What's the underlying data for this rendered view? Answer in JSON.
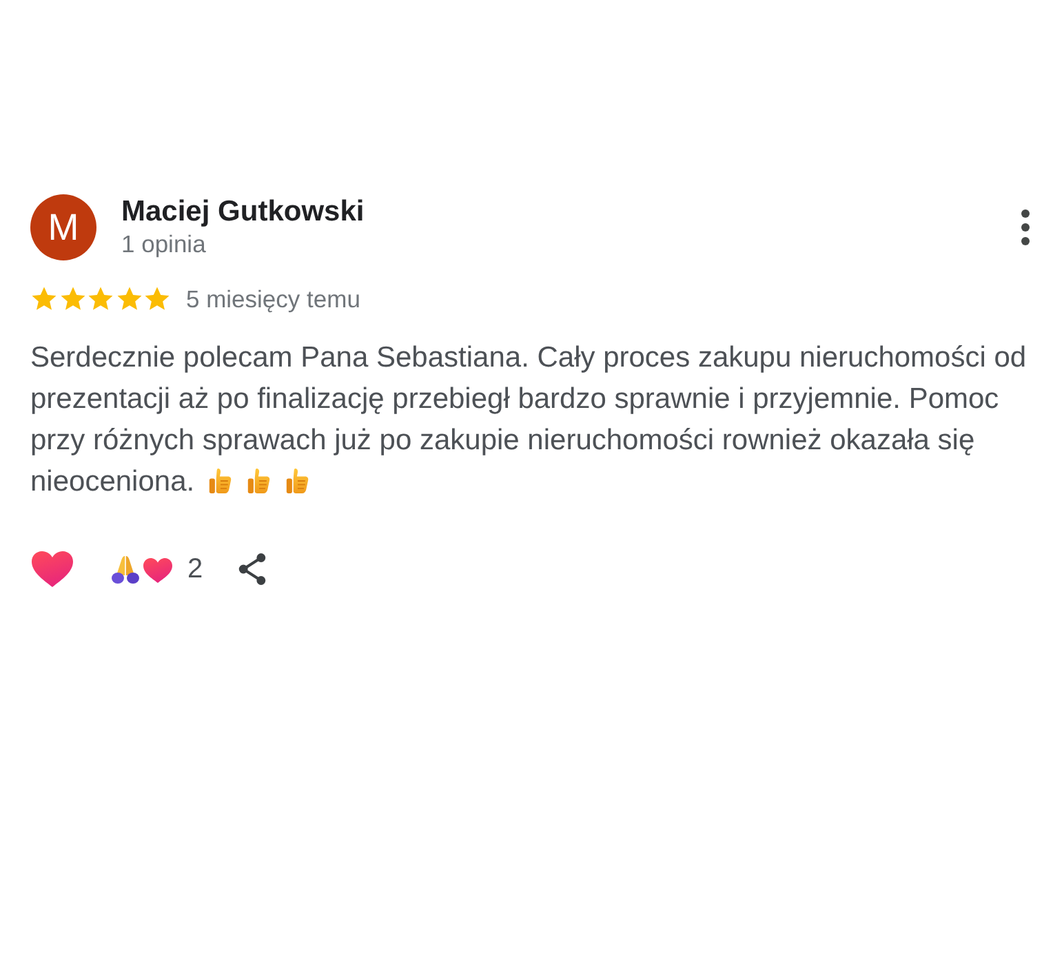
{
  "reviewer": {
    "initial": "M",
    "name": "Maciej Gutkowski",
    "review_count": "1 opinia"
  },
  "rating": {
    "stars": 5,
    "time": "5 miesięcy temu"
  },
  "review": {
    "text": "Serdecznie polecam Pana Sebastiana. Cały proces zakupu nieruchomości od prezentacji aż po finalizację przebiegł bardzo sprawnie i przyjemnie. Pomoc przy różnych sprawach już po zakupie nieruchomości rownież okazała się",
    "last_line": "nieoceniona."
  },
  "reactions": {
    "count": "2"
  }
}
